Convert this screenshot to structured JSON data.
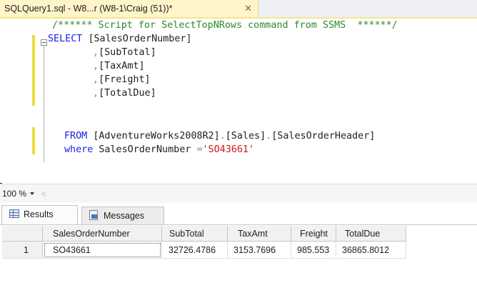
{
  "tab": {
    "title": "SQLQuery1.sql - W8...r (W8-1\\Craig (51))*",
    "close": "✕"
  },
  "editor": {
    "comment": "/****** Script for SelectTopNRows command from SSMS  ******/",
    "select_kw": "SELECT",
    "col1": "[SalesOrderNumber]",
    "comma": ",",
    "col2": "[SubTotal]",
    "col3": "[TaxAmt]",
    "col4": "[Freight]",
    "col5": "[TotalDue]",
    "from_kw": "FROM",
    "db": "[AdventureWorks2008R2]",
    "schema": "[Sales]",
    "table": "[SalesOrderHeader]",
    "dot": ".",
    "where_kw": "where",
    "where_col": "SalesOrderNumber",
    "eq": "=",
    "where_val": "'SO43661'"
  },
  "zoom": {
    "value": "100 %",
    "scroll_left": "<"
  },
  "result_tabs": {
    "results": "Results",
    "messages": "Messages"
  },
  "grid": {
    "columns": [
      "SalesOrderNumber",
      "SubTotal",
      "TaxAmt",
      "Freight",
      "TotalDue"
    ],
    "rows": [
      {
        "num": "1",
        "cells": [
          "SO43661",
          "32726.4786",
          "3153.7696",
          "985.553",
          "36865.8012"
        ]
      }
    ]
  }
}
